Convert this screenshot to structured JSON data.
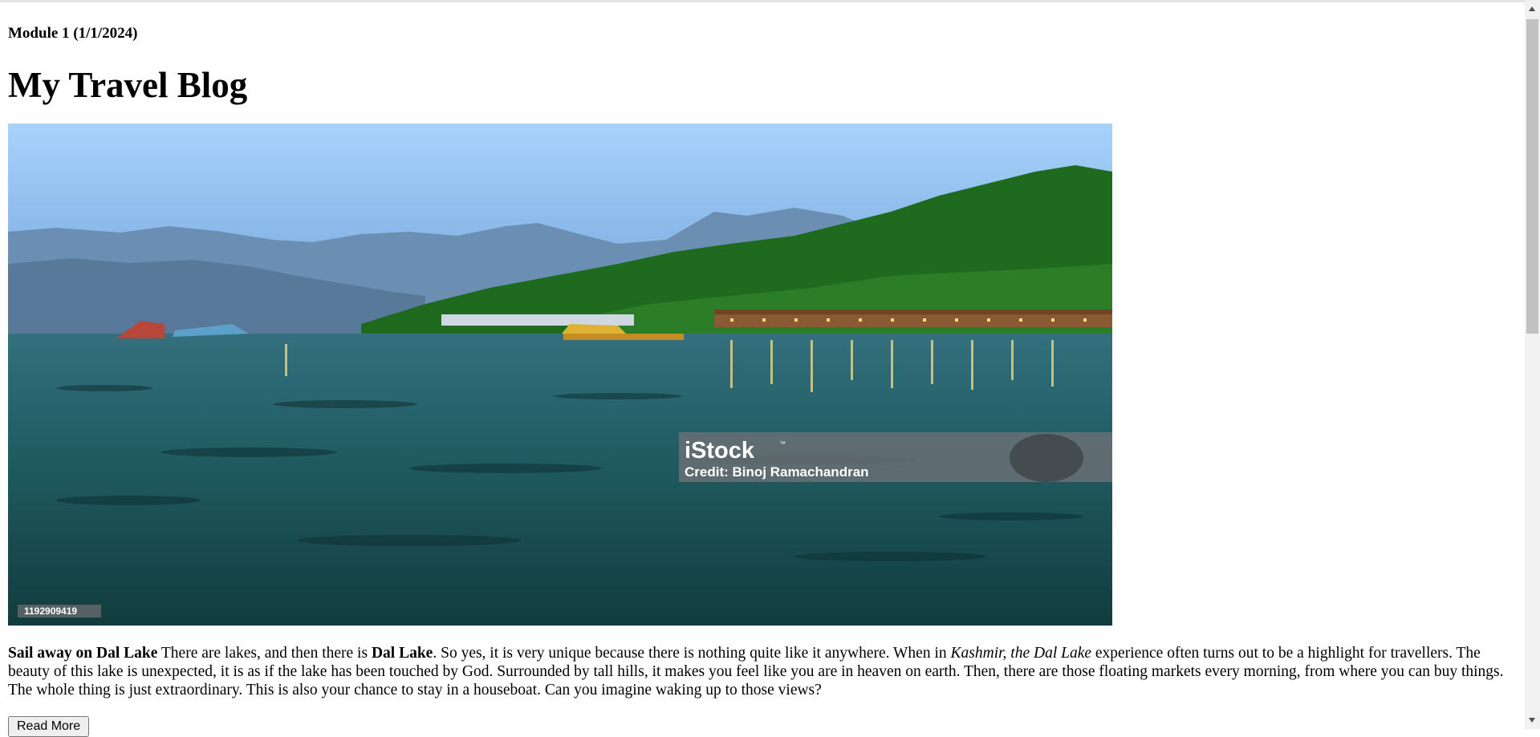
{
  "page": {
    "module_label": "Module 1 (1/1/2024)",
    "title": "My Travel Blog"
  },
  "hero_image": {
    "watermark_brand": "iStock",
    "watermark_trademark": "™",
    "watermark_credit": "Credit: Binoj Ramachandran",
    "image_id": "1192909419"
  },
  "article": {
    "lead_bold": "Sail away on Dal Lake",
    "text_1": " There are lakes, and then there is ",
    "bold_2": "Dal Lake",
    "text_2": ". So yes, it is very unique because there is nothing quite like it anywhere. When in ",
    "italic_1": "Kashmir, the Dal Lake",
    "text_3": " experience often turns out to be a highlight for travellers. The beauty of this lake is unexpected, it is as if the lake has been touched by God. Surrounded by tall hills, it makes you feel like you are in heaven on earth. Then, there are those floating markets every morning, from where you can buy things. The whole thing is just extraordinary. This is also your chance to stay in a houseboat. Can you imagine waking up to those views?"
  },
  "buttons": {
    "read_more": "Read More"
  }
}
